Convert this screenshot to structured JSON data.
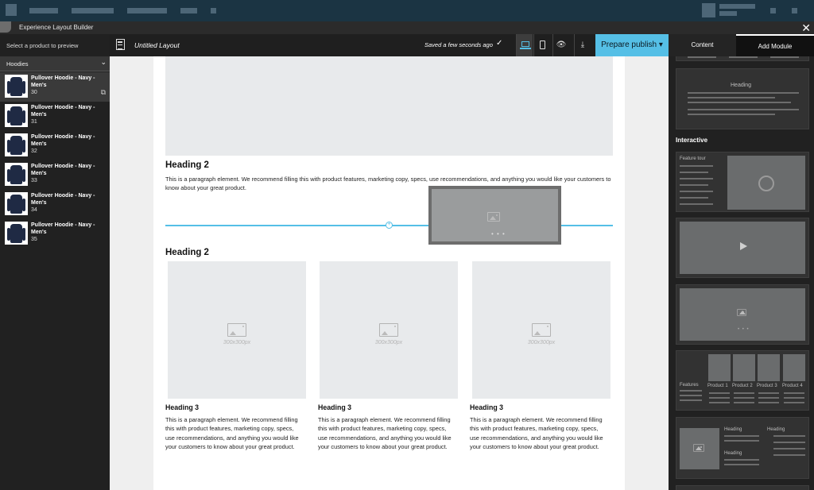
{
  "titlebar": {
    "title": "Experience Layout Builder"
  },
  "sidebar": {
    "prompt": "Select a product to preview",
    "category": "Hoodies",
    "products": [
      {
        "name": "Pullover Hoodie - Navy - Men's",
        "num": "30"
      },
      {
        "name": "Pullover Hoodie - Navy - Men's",
        "num": "31"
      },
      {
        "name": "Pullover Hoodie - Navy - Men's",
        "num": "32"
      },
      {
        "name": "Pullover Hoodie - Navy - Men's",
        "num": "33"
      },
      {
        "name": "Pullover Hoodie - Navy - Men's",
        "num": "34"
      },
      {
        "name": "Pullover Hoodie - Navy - Men's",
        "num": "35"
      }
    ]
  },
  "toolbar": {
    "layout_name": "Untitled Layout",
    "saved_status": "Saved a few seconds ago",
    "publish_label": "Prepare publish ▾"
  },
  "tabs": {
    "content": "Content",
    "add_module": "Add Module"
  },
  "canvas": {
    "section1": {
      "heading": "Heading 2",
      "paragraph": "This is a paragraph element. We recommend filling this with product features, marketing copy, specs, use recommendations, and anything you would like your customers to know about your great product."
    },
    "section2": {
      "heading": "Heading 2",
      "cards": [
        {
          "img_label": "300x300px",
          "heading": "Heading 3",
          "paragraph": "This is a paragraph element. We recommend filling this with product features, marketing copy, specs, use recommendations, and anything you would like your customers to know about your great product."
        },
        {
          "img_label": "300x300px",
          "heading": "Heading 3",
          "paragraph": "This is a paragraph element. We recommend filling this with product features, marketing copy, specs, use recommendations, and anything you would like your customers to know about your great product."
        },
        {
          "img_label": "300x300px",
          "heading": "Heading 3",
          "paragraph": "This is a paragraph element. We recommend filling this with product features, marketing copy, specs, use recommendations, and anything you would like your customers to know about your great product."
        }
      ]
    }
  },
  "modules": {
    "heading_module": {
      "heading": "Heading"
    },
    "interactive_label": "Interactive",
    "feature_tour": {
      "label": "Feature tour"
    },
    "features_module": {
      "label": "Features",
      "products": [
        "Product 1",
        "Product 2",
        "Product 3",
        "Product 4"
      ]
    },
    "content_module": {
      "heading_a": "Heading",
      "heading_b": "Heading",
      "heading_c": "Heading"
    }
  },
  "colors": {
    "accent": "#55bfe6",
    "topnav": "#1b3443",
    "panel": "#212121"
  }
}
